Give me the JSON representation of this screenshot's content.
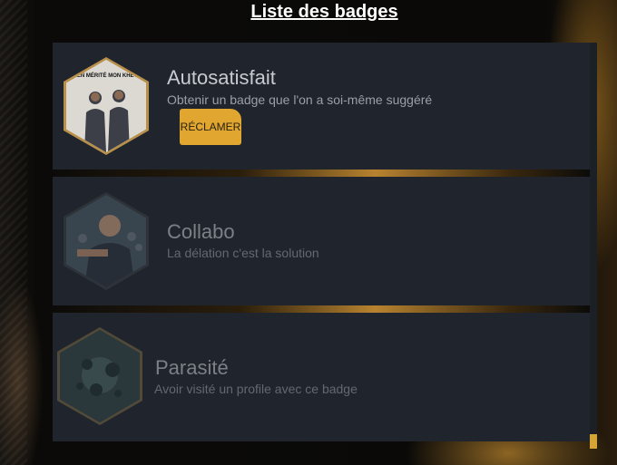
{
  "page": {
    "title": "Liste des badges"
  },
  "colors": {
    "accent": "#e0a630",
    "card_bg": "#20242c",
    "badge_border_gold": "#b8904a"
  },
  "badges": [
    {
      "name": "Autosatisfait",
      "description": "Obtenir un badge que l'on a soi-même suggéré",
      "image_caption": "BIEN MÉRITÉ MON KHEY !",
      "action_label": "RÉCLAMER",
      "claimable": true
    },
    {
      "name": "Collabo",
      "description": "La délation c'est la solution",
      "claimable": false
    },
    {
      "name": "Parasité",
      "description": "Avoir visité un profile avec ce badge",
      "claimable": false
    }
  ]
}
